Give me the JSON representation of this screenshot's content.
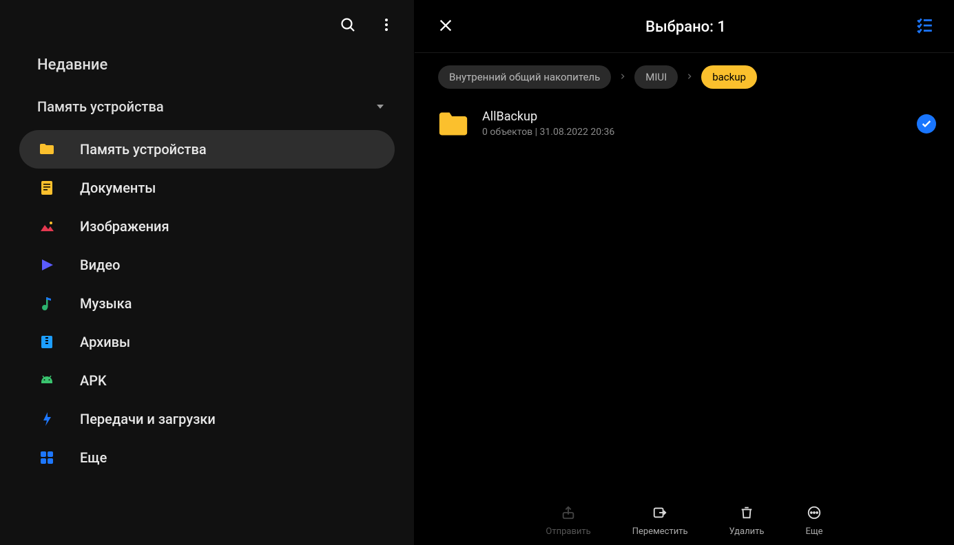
{
  "sidebar": {
    "section_title": "Недавние",
    "dropdown_label": "Память устройства",
    "items": [
      {
        "label": "Память устройства"
      },
      {
        "label": "Документы"
      },
      {
        "label": "Изображения"
      },
      {
        "label": "Видео"
      },
      {
        "label": "Музыка"
      },
      {
        "label": "Архивы"
      },
      {
        "label": "APK"
      },
      {
        "label": "Передачи и загрузки"
      },
      {
        "label": "Еще"
      }
    ]
  },
  "main": {
    "title": "Выбрано: 1",
    "breadcrumbs": [
      "Внутренний общий накопитель",
      "MIUI",
      "backup"
    ],
    "files": [
      {
        "name": "AllBackup",
        "meta": "0 объектов  |  31.08.2022 20:36"
      }
    ]
  },
  "bottombar": {
    "send": "Отправить",
    "move": "Переместить",
    "delete": "Удалить",
    "more": "Еще"
  }
}
